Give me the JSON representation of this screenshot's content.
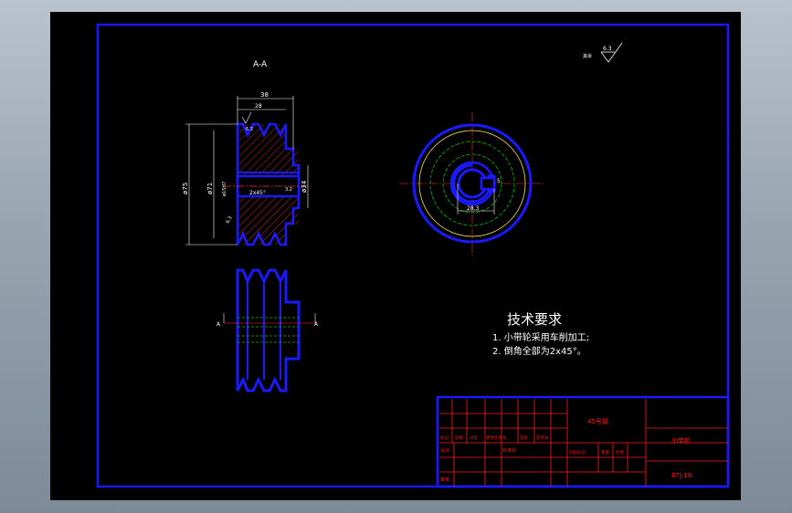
{
  "view_label": "A-A",
  "section_markers": {
    "left": "A",
    "right": "A"
  },
  "roughness": {
    "symbol_value": "6.3",
    "prefix": "其余"
  },
  "dimensions": {
    "width_total": "38",
    "width_grooves": "28",
    "dia_outer": "ø75",
    "dia_pitch": "ø71",
    "dia_bore": "ø15H7",
    "dia_hub": "ø34",
    "chamfer": "2x45°",
    "keyway_depth": "5",
    "keyway_width": "28.3",
    "roughness_hub": "6.3",
    "roughness_bore": "3.2",
    "roughness_face": "6.3"
  },
  "notes": {
    "title": "技术要求",
    "line1": "1. 小带轮采用车削加工;",
    "line2": "2. 倒角全部为2x45°。"
  },
  "title_block": {
    "material": "45号钢",
    "part_name": "小带轮",
    "drawing_no": "BTJ-16",
    "row_labels": {
      "design": "设计",
      "review": "审核",
      "craft": "工艺"
    },
    "std_label": "标准化",
    "header_cells": [
      "标记",
      "处数",
      "分区",
      "更改文件号",
      "签名",
      "年月日"
    ],
    "stage_cells": [
      "阶段标记",
      "重量",
      "比例"
    ]
  },
  "colors": {
    "outline": "#1a1aff",
    "hatch": "#ff3030",
    "dim": "#ffffff",
    "frame": "#1a1aff",
    "center": "#ff3030",
    "hidden": "#00c000",
    "titleblock": "#ff1a1a"
  }
}
